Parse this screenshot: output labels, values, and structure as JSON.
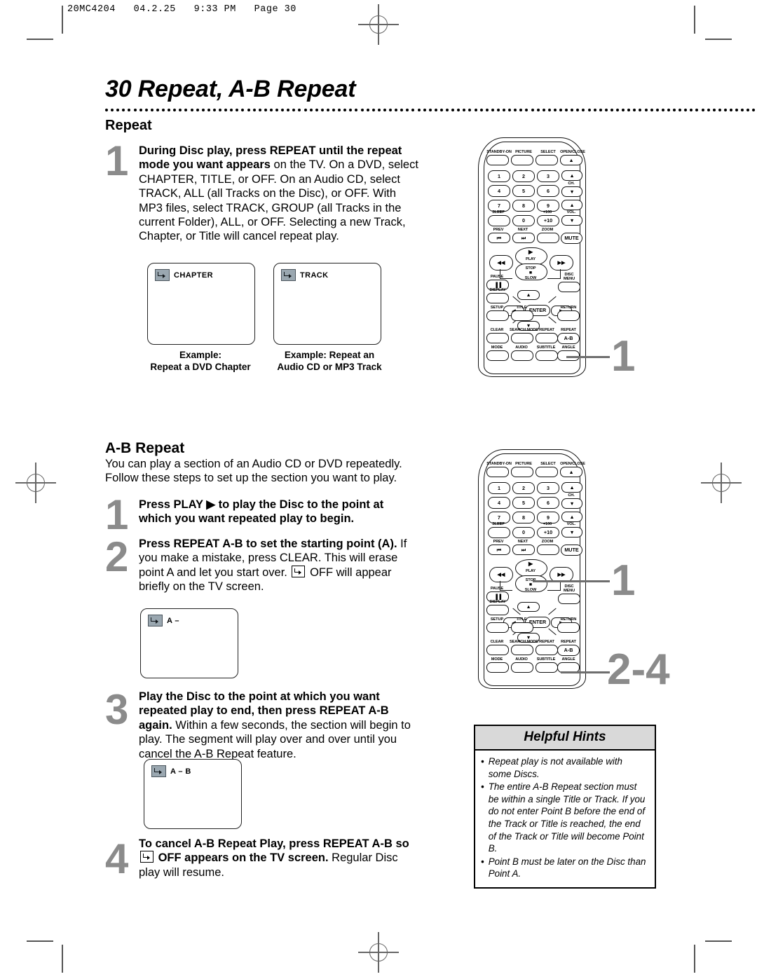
{
  "page": {
    "runhead": "20MC4204   04.2.25   9:33 PM   Page 30",
    "title": "30  Repeat, A-B Repeat"
  },
  "sections": {
    "repeat_heading": "Repeat",
    "abrepeat_heading": "A-B Repeat",
    "abrepeat_intro_line1": "You can play a section of an Audio CD or DVD repeatedly.",
    "abrepeat_intro_line2": "Follow these steps to set up the section you want to play."
  },
  "repeat_step": {
    "num": "1",
    "bold_lead": "During Disc play, press REPEAT until the repeat mode you want appears",
    "lead_tail": " on the TV.",
    "rest": "On a DVD, select CHAPTER, TITLE, or OFF. On an Audio CD, select TRACK, ALL (all Tracks on the Disc), or OFF. With MP3 files, select TRACK, GROUP (all Tracks in the current Folder), ALL, or OFF. Selecting a new Track, Chapter, or Title will cancel repeat play."
  },
  "screens": [
    {
      "icon": "repeat-osd-icon",
      "label": "CHAPTER",
      "caption_line1": "Example:",
      "caption_line2": "Repeat a DVD Chapter"
    },
    {
      "icon": "repeat-osd-icon",
      "label": "TRACK",
      "caption_line1": "Example: Repeat an",
      "caption_line2": "Audio CD or MP3 Track"
    }
  ],
  "ab_steps": [
    {
      "num": "1",
      "bold": "Press PLAY ▶ to play the Disc to the point at which you want repeated play to begin.",
      "plain": ""
    },
    {
      "num": "2",
      "bold": "Press REPEAT A-B to set the starting point (A).",
      "plain_a": "If you make a mistake, press CLEAR. This will erase point A and let you start over. ",
      "plain_b": " OFF will appear briefly on the TV screen."
    },
    {
      "num": "3",
      "bold": "Play the Disc to the point at which you want repeated play to end, then press REPEAT A-B again.",
      "plain": " Within a few seconds, the section will begin to play. The segment will play over and over until you cancel the A-B Repeat feature."
    },
    {
      "num": "4",
      "bold_a": "To cancel A-B Repeat Play, press REPEAT A-B so ",
      "bold_b": " OFF appears on the TV screen.",
      "plain": " Regular Disc play will resume."
    }
  ],
  "ab_screens": [
    {
      "icon": "repeat-osd-icon",
      "label": "A –"
    },
    {
      "icon": "repeat-osd-icon",
      "label": "A – B"
    }
  ],
  "remote": {
    "row_top": [
      "STANDBY-ON",
      "PICTURE",
      "SELECT",
      "OPEN/CLOSE"
    ],
    "open_close_glyph": "▲",
    "keys": [
      "1",
      "2",
      "3",
      "4",
      "5",
      "6",
      "7",
      "8",
      "9",
      "0",
      "+10"
    ],
    "plus100": "+100",
    "sleep": "SLEEP",
    "ch": "CH.",
    "vol": "VOL.",
    "up_glyph": "▲",
    "down_glyph": "▼",
    "prev": "PREV",
    "next": "NEXT",
    "zoom": "ZOOM",
    "mute": "MUTE",
    "prev_glyph": "⏮",
    "next_glyph": "⏭",
    "play": "PLAY",
    "play_glyph": "▶",
    "stop": "STOP",
    "stop_glyph": "■",
    "rew_glyph": "◀◀",
    "ff_glyph": "▶▶",
    "pause": "PAUSE",
    "pause_glyph": "▐▐",
    "slow": "SLOW",
    "disc_menu_l1": "DISC",
    "disc_menu_l2": "MENU",
    "display": "DISPLAY",
    "enter": "ENTER",
    "left_glyph": "◀",
    "right_glyph": "▶",
    "setup": "SETUP",
    "title": "TITLE",
    "return": "RETURN",
    "clear": "CLEAR",
    "search_mode": "SEARCH MODE",
    "repeat": "REPEAT",
    "repeat_ab_label": "REPEAT",
    "repeat_ab_key": "A-B",
    "mode": "MODE",
    "audio": "AUDIO",
    "subtitle": "SUBTITLE",
    "angle": "ANGLE"
  },
  "callouts": {
    "remote1": "1",
    "remote2_play": "1",
    "remote2_ab": "2-4"
  },
  "hints": {
    "title": "Helpful Hints",
    "bullet": "•",
    "items": [
      "Repeat play is not available with some Discs.",
      "The entire A-B Repeat section must be within a single Title or Track. If you do not enter Point B before the end of the Track or Title is reached, the end of the Track or Title will become Point B.",
      "Point B must be later on the Disc than Point A."
    ]
  }
}
